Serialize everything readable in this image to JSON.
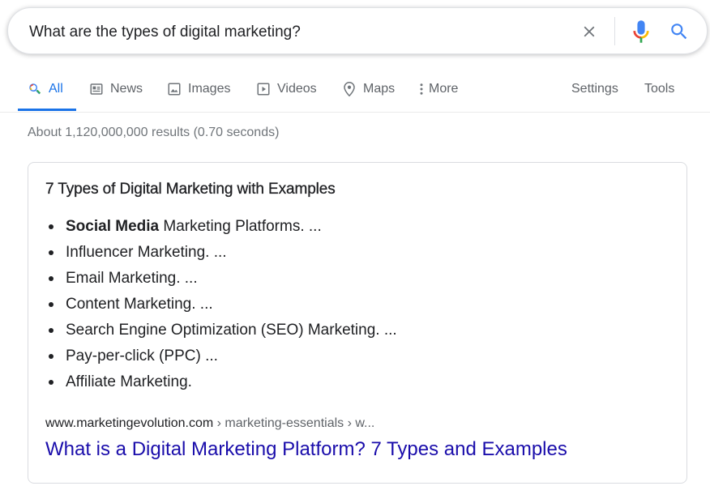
{
  "search": {
    "query": "What are the types of digital marketing?",
    "placeholder": ""
  },
  "icons": {
    "clear": "close-icon",
    "mic": "microphone-icon",
    "search": "search-icon"
  },
  "colors": {
    "accent_blue": "#1a73e8",
    "link": "#1a0dab",
    "muted_text": "#70757a",
    "tab_text": "#5f6368",
    "mic_blue": "#4285f4",
    "mic_red": "#ea4335",
    "mic_yellow": "#fbbc04",
    "mic_green": "#34a853"
  },
  "tabs": [
    {
      "label": "All",
      "icon": "search-icon",
      "active": true
    },
    {
      "label": "News",
      "icon": "newspaper-icon",
      "active": false
    },
    {
      "label": "Images",
      "icon": "image-icon",
      "active": false
    },
    {
      "label": "Videos",
      "icon": "video-play-icon",
      "active": false
    },
    {
      "label": "Maps",
      "icon": "map-pin-icon",
      "active": false
    },
    {
      "label": "More",
      "icon": "more-vertical-icon",
      "active": false
    }
  ],
  "tools": {
    "settings_label": "Settings",
    "tools_label": "Tools"
  },
  "result_stats": "About 1,120,000,000 results (0.70 seconds)",
  "featured_snippet": {
    "heading": "7 Types of Digital Marketing with Examples",
    "items": [
      {
        "bold": "Social Media",
        "text": " Marketing Platforms. ..."
      },
      {
        "bold": "",
        "text": "Influencer Marketing. ..."
      },
      {
        "bold": "",
        "text": "Email Marketing. ..."
      },
      {
        "bold": "",
        "text": "Content Marketing. ..."
      },
      {
        "bold": "",
        "text": "Search Engine Optimization (SEO) Marketing. ..."
      },
      {
        "bold": "",
        "text": "Pay-per-click (PPC) ..."
      },
      {
        "bold": "",
        "text": "Affiliate Marketing."
      }
    ],
    "cite_domain": "www.marketingevolution.com",
    "cite_path": " › marketing-essentials › w...",
    "link_title": "What is a Digital Marketing Platform? 7 Types and Examples"
  }
}
